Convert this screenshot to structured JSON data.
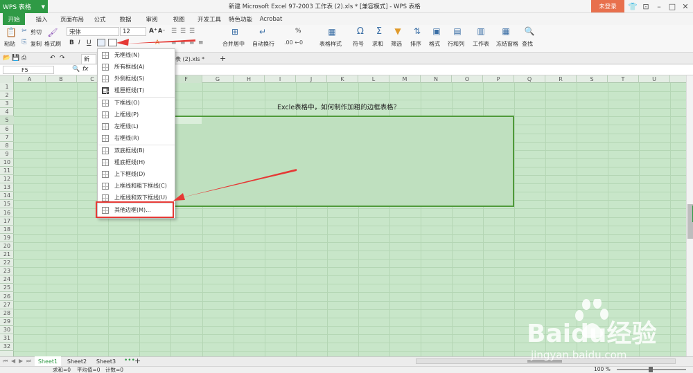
{
  "title_bar": {
    "app_button": "WPS 表格",
    "title": "新建 Microsoft Excel 97-2003 工作表 (2).xls * [兼容模式] - WPS 表格",
    "login_button": "未登录"
  },
  "tabs": [
    "开始",
    "插入",
    "页面布局",
    "公式",
    "数据",
    "审阅",
    "视图",
    "开发工具",
    "特色功能",
    "Acrobat"
  ],
  "active_tab": "开始",
  "ribbon": {
    "paste_label": "粘贴",
    "cut_label": "剪切",
    "copy_label": "复制",
    "format_painter_label": "格式刷",
    "font_name": "宋体",
    "font_size": "12",
    "bold": "B",
    "italic": "I",
    "underline": "U",
    "merge_center_label": "合并居中",
    "wrap_text_label": "自动换行",
    "percent": "%",
    "table_style_label": "表格样式",
    "symbol_label": "符号",
    "sum_label": "求和",
    "filter_label": "筛选",
    "sort_label": "排序",
    "format_label": "格式",
    "rowcol_label": "行和列",
    "worksheet_label": "工作表",
    "freeze_label": "冻结窗格",
    "find_label": "查找"
  },
  "doc_tab": {
    "partial_label_1": "新",
    "partial_label_2": "表 (2).xls *",
    "add": "+"
  },
  "formula_bar": {
    "name_box": "F5",
    "fx": "fx",
    "value": ""
  },
  "columns": [
    "A",
    "B",
    "C",
    "D",
    "E",
    "F",
    "G",
    "H",
    "I",
    "J",
    "K",
    "L",
    "M",
    "N",
    "O",
    "P",
    "Q",
    "R",
    "S",
    "T",
    "U"
  ],
  "rows": [
    "1",
    "2",
    "3",
    "4",
    "5",
    "6",
    "7",
    "8",
    "9",
    "10",
    "11",
    "12",
    "13",
    "14",
    "15",
    "16",
    "17",
    "18",
    "19",
    "20",
    "21",
    "22",
    "23",
    "24",
    "25",
    "26",
    "27",
    "28",
    "29",
    "30",
    "31",
    "32"
  ],
  "cell_text": "Excle表格中，如何制作加粗的边框表格？",
  "border_menu": {
    "groups": [
      [
        "无框线(N)",
        "所有框线(A)",
        "外侧框线(S)",
        "粗匣框线(T)"
      ],
      [
        "下框线(O)",
        "上框线(P)",
        "左框线(L)",
        "右框线(R)"
      ],
      [
        "双底框线(B)",
        "粗底框线(H)",
        "上下框线(D)",
        "上框线和粗下框线(C)",
        "上框线和双下框线(U)"
      ],
      [
        "其他边框(M)..."
      ]
    ]
  },
  "sheets": [
    "Sheet1",
    "Sheet2",
    "Sheet3"
  ],
  "active_sheet": "Sheet1",
  "status_bar": {
    "sum": "求和=0",
    "avg": "平均值=0",
    "count": "计数=0",
    "zoom": "100 %"
  },
  "watermark": {
    "brand": "Baidu经验",
    "url": "jingyan.baidu.com"
  },
  "colors": {
    "accent_green": "#2f9a45",
    "login_orange": "#e8704d",
    "highlight_red": "#e53935",
    "sheet_bg": "#c8e6c9"
  }
}
